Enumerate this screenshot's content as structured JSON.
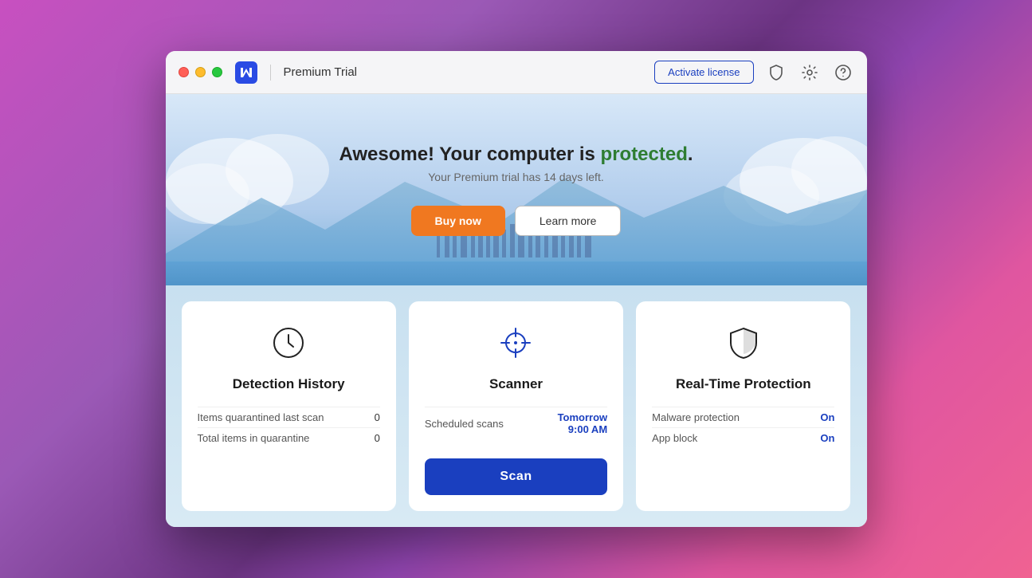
{
  "window": {
    "title": "Premium Trial",
    "traffic_lights": {
      "red_label": "close",
      "yellow_label": "minimize",
      "green_label": "maximize"
    }
  },
  "header": {
    "activate_label": "Activate license",
    "shield_icon": "shield-icon",
    "gear_icon": "gear-icon",
    "help_icon": "help-icon"
  },
  "hero": {
    "title_prefix": "Awesome! Your computer is ",
    "title_highlight": "protected",
    "title_suffix": ".",
    "subtitle": "Your Premium trial has 14 days left.",
    "buy_button": "Buy now",
    "learn_button": "Learn more"
  },
  "cards": {
    "detection": {
      "title": "Detection History",
      "stats": [
        {
          "label": "Items quarantined last scan",
          "value": "0"
        },
        {
          "label": "Total items in quarantine",
          "value": "0"
        }
      ]
    },
    "scanner": {
      "title": "Scanner",
      "stats": [
        {
          "label": "Scheduled scans",
          "value": "Tomorrow\n9:00 AM"
        }
      ],
      "scan_button": "Scan"
    },
    "protection": {
      "title": "Real-Time Protection",
      "stats": [
        {
          "label": "Malware protection",
          "value": "On"
        },
        {
          "label": "App block",
          "value": "On"
        }
      ]
    }
  }
}
